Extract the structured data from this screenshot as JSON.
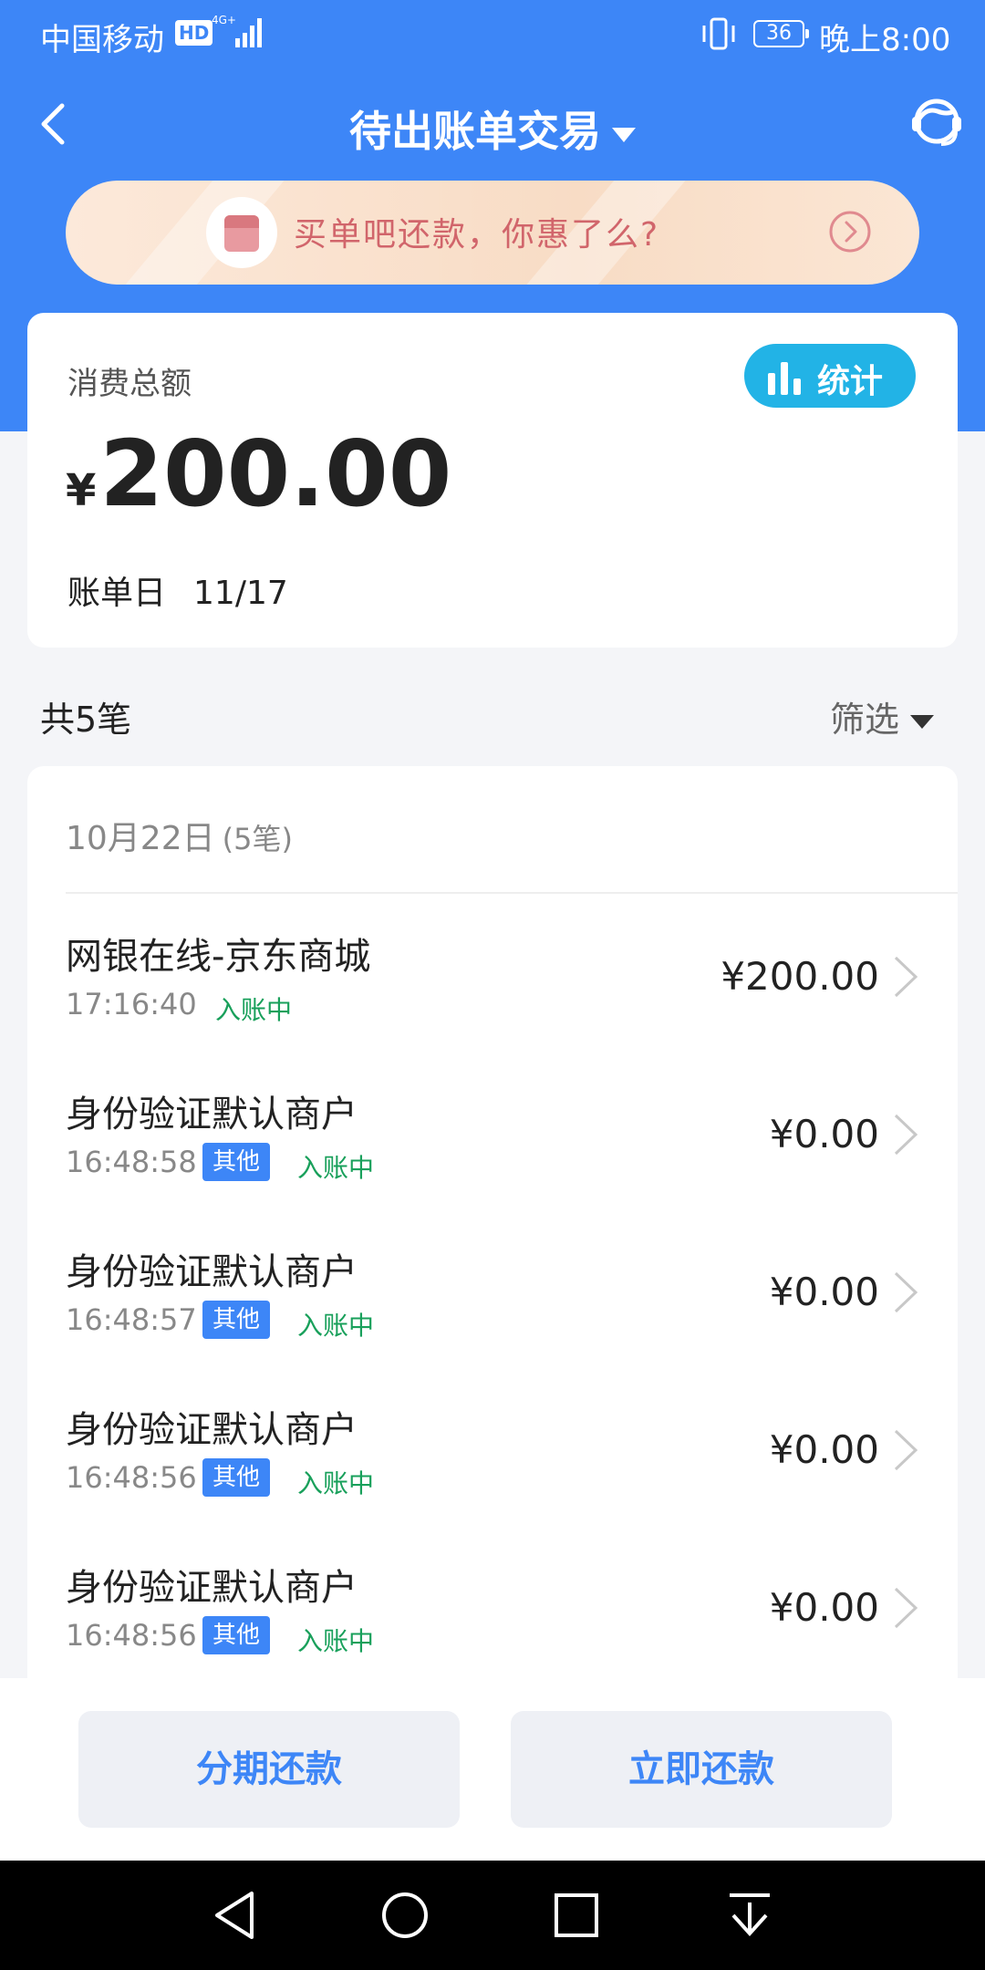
{
  "status_bar": {
    "carrier": "中国移动",
    "hd": "HD",
    "battery": "36",
    "time": "晚上8:00"
  },
  "nav": {
    "title": "待出账单交易",
    "back_icon": "chevron-left-icon",
    "service_icon": "customer-service-icon"
  },
  "promo": {
    "text": "买单吧还款，你惠了么?"
  },
  "summary": {
    "label": "消费总额",
    "stats_label": "统计",
    "currency": "¥",
    "amount": "200.00",
    "bill_date_label": "账单日",
    "bill_date": "11/17"
  },
  "list_header": {
    "count": "共5笔",
    "filter": "筛选"
  },
  "group": {
    "date": "10月22日",
    "count": "(5笔)"
  },
  "transactions": [
    {
      "name": "网银在线-京东商城",
      "time": "17:16:40",
      "tag": "",
      "status": "入账中",
      "amount": "¥200.00"
    },
    {
      "name": "身份验证默认商户",
      "time": "16:48:58",
      "tag": "其他",
      "status": "入账中",
      "amount": "¥0.00"
    },
    {
      "name": "身份验证默认商户",
      "time": "16:48:57",
      "tag": "其他",
      "status": "入账中",
      "amount": "¥0.00"
    },
    {
      "name": "身份验证默认商户",
      "time": "16:48:56",
      "tag": "其他",
      "status": "入账中",
      "amount": "¥0.00"
    },
    {
      "name": "身份验证默认商户",
      "time": "16:48:56",
      "tag": "其他",
      "status": "入账中",
      "amount": "¥0.00"
    }
  ],
  "actions": {
    "installment": "分期还款",
    "repay_now": "立即还款"
  },
  "colors": {
    "primary": "#3D86F7",
    "stats": "#22B3E6",
    "status_green": "#19A05B",
    "promo_text": "#D1656B"
  }
}
